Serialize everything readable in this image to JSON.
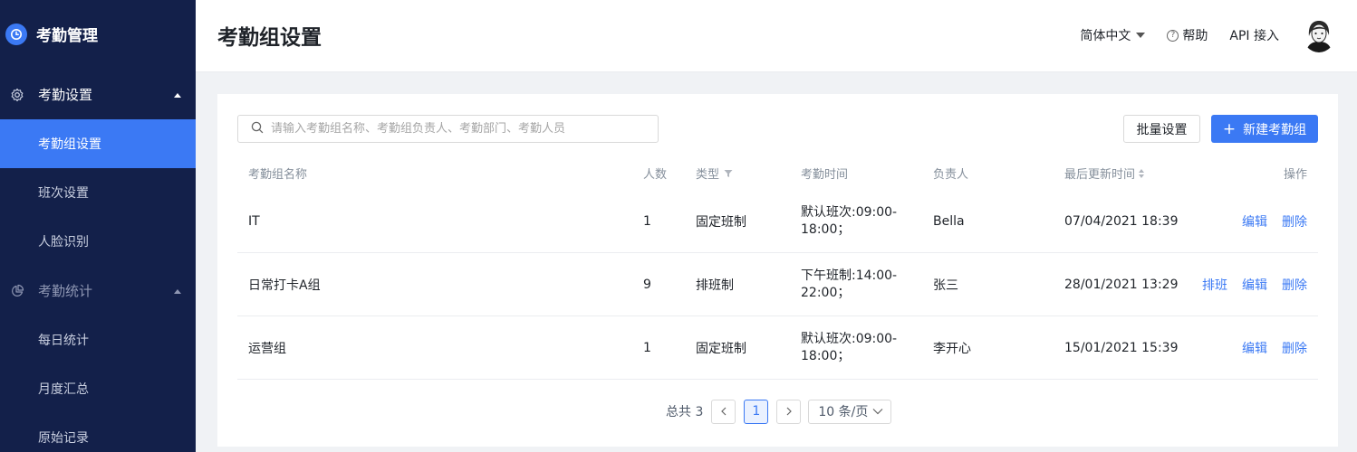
{
  "sidebar": {
    "brand": "考勤管理",
    "groups": [
      {
        "label": "考勤设置",
        "icon": "gear-icon",
        "items": [
          "考勤组设置",
          "班次设置",
          "人脸识别"
        ]
      },
      {
        "label": "考勤统计",
        "icon": "pie-chart-icon",
        "items": [
          "每日统计",
          "月度汇总",
          "原始记录"
        ]
      }
    ],
    "active_item": "考勤组设置"
  },
  "header": {
    "title": "考勤组设置",
    "language": "简体中文",
    "help": "帮助",
    "api": "API 接入"
  },
  "toolbar": {
    "search_placeholder": "请输入考勤组名称、考勤组负责人、考勤部门、考勤人员",
    "batch_label": "批量设置",
    "new_label": "新建考勤组"
  },
  "table": {
    "columns": {
      "name": "考勤组名称",
      "count": "人数",
      "type": "类型",
      "time": "考勤时间",
      "owner": "负责人",
      "updated": "最后更新时间",
      "ops": "操作"
    },
    "rows": [
      {
        "name": "IT",
        "count": "1",
        "type": "固定班制",
        "time": "默认班次:09:00-18:00；",
        "owner": "Bella",
        "updated": "07/04/2021 18:39",
        "schedule": "",
        "edit": "编辑",
        "delete": "删除"
      },
      {
        "name": "日常打卡A组",
        "count": "9",
        "type": "排班制",
        "time": "下午班制:14:00-22:00；",
        "owner": "张三",
        "updated": "28/01/2021 13:29",
        "schedule": "排班",
        "edit": "编辑",
        "delete": "删除"
      },
      {
        "name": "运营组",
        "count": "1",
        "type": "固定班制",
        "time": "默认班次:09:00-18:00；",
        "owner": "李开心",
        "updated": "15/01/2021 15:39",
        "schedule": "",
        "edit": "编辑",
        "delete": "删除"
      }
    ]
  },
  "pagination": {
    "total": "总共 3",
    "current": "1",
    "page_size": "10 条/页"
  },
  "colors": {
    "accent": "#3b79f4",
    "sidebar_bg": "#13204a"
  }
}
